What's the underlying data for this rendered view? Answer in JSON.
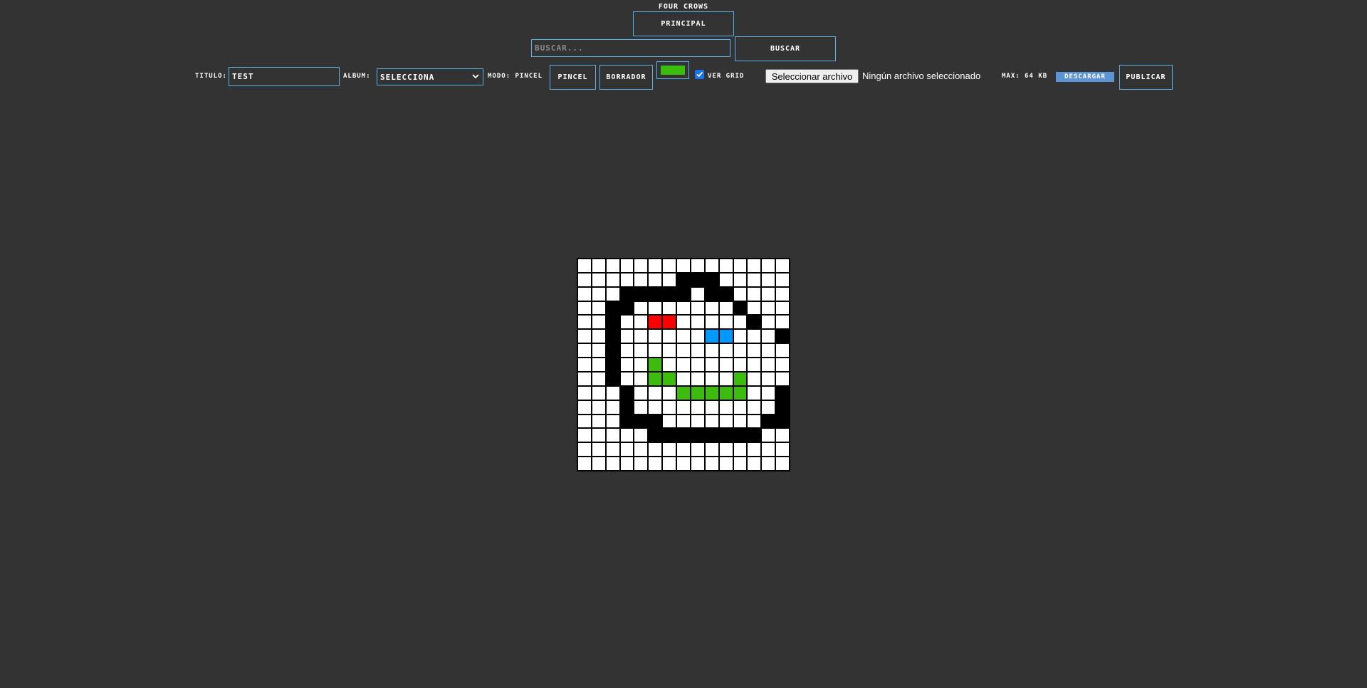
{
  "header": {
    "brand": "FOUR CROWS",
    "principal_label": "PRINCIPAL"
  },
  "search": {
    "placeholder": "BUSCAR...",
    "value": "",
    "button_label": "BUSCAR"
  },
  "toolbar": {
    "titulo_label": "TITULO:",
    "titulo_value": "TEST",
    "album_label": "ALBUM:",
    "album_selected": "SELECCIONA",
    "modo_label": "MODO: PINCEL",
    "pincel_label": "PINCEL",
    "borrador_label": "BORRADOR",
    "current_color": "#3cbc0c",
    "ver_grid_checked": true,
    "ver_grid_label": "VER GRID",
    "file_button_label": "Seleccionar archivo",
    "file_status": "Ningún archivo seleccionado",
    "max_label": "MAX: 64 KB",
    "descargar_label": "DESCARGAR",
    "publicar_label": "PUBLICAR"
  },
  "canvas": {
    "size": 15,
    "palette": {
      "W": "#ffffff",
      "K": "#000000",
      "R": "#ff0000",
      "B": "#0099ff",
      "G": "#3cbc0c"
    },
    "rows": [
      "WWWWWWWWWWWWWWW",
      "WWWWWWWKKKWWWWW",
      "WWWKKKKKWKKWWWW",
      "WWKKWWWWWWWKWWW",
      "WWKWWRRWWWWWKWW",
      "WWKWWWWWWBBWWWK",
      "WWKWWWWWWWWWWWW",
      "WWKWWGWWWWWWWWW",
      "WWKWWGGWWWWGWWW",
      "WWWKWWWGGGGGWWK",
      "WWWKWWWWWWWWWWK",
      "WWWKKKWWWWWWWKK",
      "WWWWWKKKKKKKKWW",
      "WWWWWWWWWWWWWWW",
      "WWWWWWWWWWWWWWW"
    ]
  }
}
